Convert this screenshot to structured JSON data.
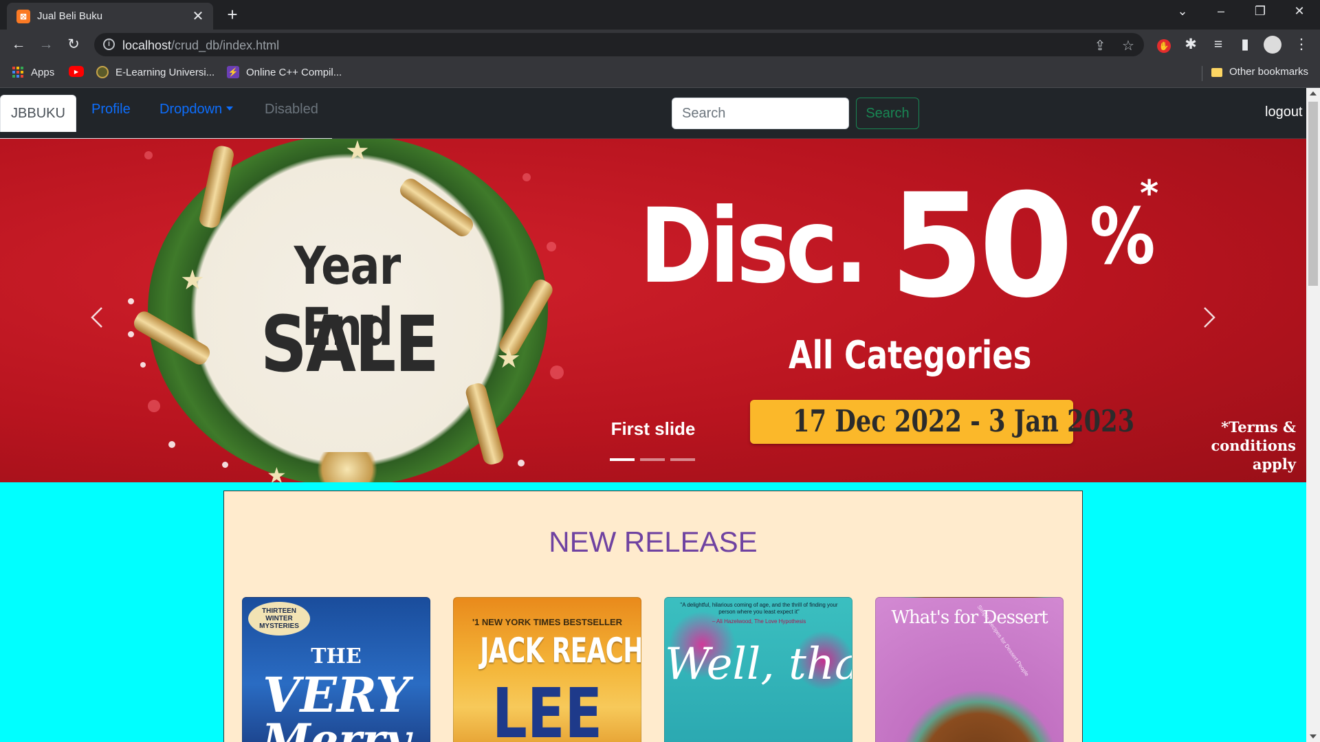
{
  "browser": {
    "tab_title": "Jual Beli Buku",
    "favicon_glyph": "⊠",
    "url_host": "localhost",
    "url_path": "/crud_db/index.html"
  },
  "bookmarks": {
    "apps": "Apps",
    "items": [
      "E-Learning Universi...",
      "Online C++ Compil..."
    ],
    "other": "Other bookmarks"
  },
  "navbar": {
    "brand": "JBBUKU",
    "links": [
      "Profile",
      "Dropdown",
      "Disabled"
    ],
    "search_placeholder": "Search",
    "search_button": "Search",
    "logout": "logout"
  },
  "carousel": {
    "banner_line1": "Year End",
    "banner_line2": "SALE",
    "disc_word": "Disc.",
    "disc_value": "50",
    "disc_percent": "%",
    "disc_asterisk": "*",
    "categories": "All Categories",
    "date_range": "17 Dec 2022 - 3 Jan 2023",
    "terms": "*Terms & conditions apply",
    "caption": "First slide",
    "active_slide": 1,
    "slide_count": 3
  },
  "release": {
    "title": "NEW RELEASE",
    "books": [
      {
        "title_line1": "THE",
        "title_line2": "VERY",
        "title_line3": "Merry",
        "badge": "THIRTEEN WINTER MYSTERIES"
      },
      {
        "top": "'1 NEW YORK TIMES BESTSELLER",
        "title": "JACK REACHER",
        "author": "LEE"
      },
      {
        "quote": "\"A delightful, hilarious coming of age, and the thrill of finding your person where you least expect it\"",
        "quote_by": "– Ali Hazelwood, The Love Hypothesis",
        "title": "Well, that"
      },
      {
        "title": "What's for Dessert",
        "subtitle": "Simple Recipes for Dessert People"
      }
    ]
  },
  "colors": {
    "navbar_bg": "#212529",
    "page_bg": "#00ffff",
    "release_bg": "#ffebcd",
    "release_title": "#6f42a1",
    "banner_red": "#b8141f",
    "date_yellow": "#fbb82a"
  }
}
